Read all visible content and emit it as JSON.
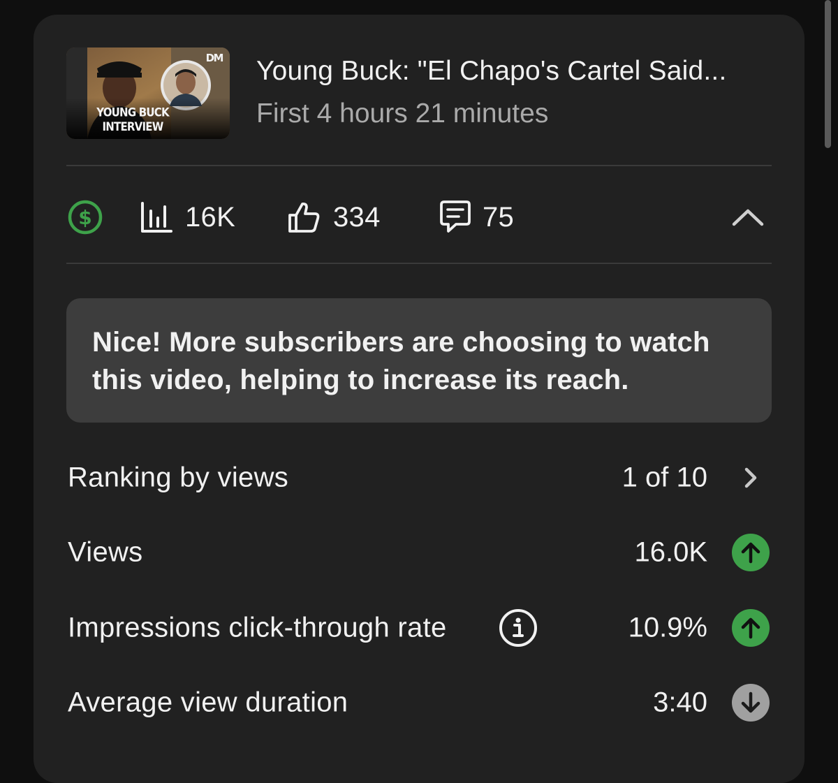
{
  "video": {
    "title": "Young Buck: \"El Chapo's Cartel Said...",
    "subtitle": "First 4 hours 21 minutes",
    "thumbnail": {
      "caption": "YOUNG BUCK INTERVIEW",
      "logo": "DM"
    }
  },
  "stats": {
    "monetization_icon": "dollar-circle-icon",
    "views": {
      "icon": "bar-chart-icon",
      "value": "16K"
    },
    "likes": {
      "icon": "thumbs-up-icon",
      "value": "334"
    },
    "comments": {
      "icon": "comment-icon",
      "value": "75"
    },
    "collapse_icon": "chevron-up-icon"
  },
  "message": "Nice! More subscribers are choosing to watch this video, helping to increase its reach.",
  "metrics": [
    {
      "label": "Ranking by views",
      "value": "1 of 10",
      "indicator": "chevron-right-icon"
    },
    {
      "label": "Views",
      "value": "16.0K",
      "indicator": "arrow-up-icon"
    },
    {
      "label": "Impressions click-through rate",
      "value": "10.9%",
      "indicator": "arrow-up-icon",
      "info_icon": "info-icon"
    },
    {
      "label": "Average view duration",
      "value": "3:40",
      "indicator": "arrow-down-icon"
    }
  ],
  "colors": {
    "background": "#0f0f0f",
    "card": "#212121",
    "message_box": "#3d3d3d",
    "positive": "#3ea24a",
    "neutral": "#a0a0a0",
    "secondary_text": "#aaaaaa"
  }
}
